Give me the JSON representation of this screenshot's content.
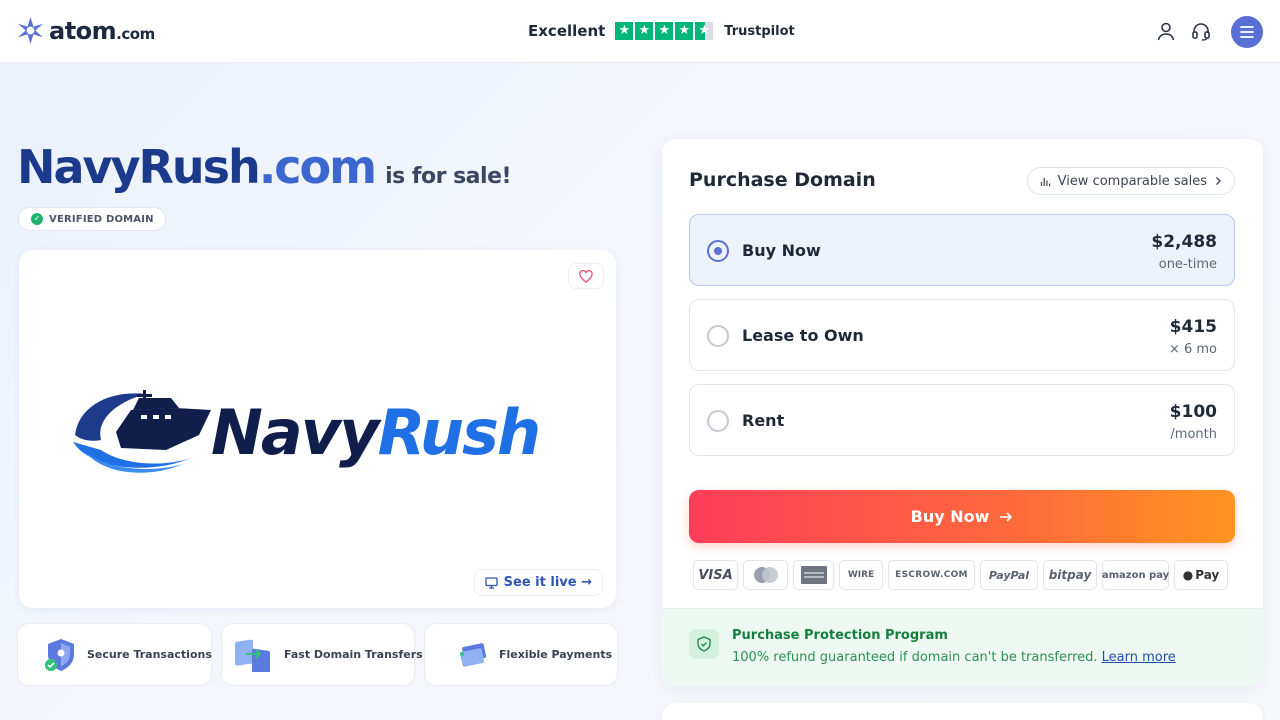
{
  "header": {
    "logo": {
      "main": "atom",
      "suffix": ".com"
    },
    "trust": {
      "label": "Excellent",
      "rating": 4.5,
      "provider": "Trustpilot"
    },
    "icons": [
      "user-icon",
      "headset-icon",
      "menu-icon"
    ]
  },
  "hero": {
    "domain_name": "NavyRush",
    "domain_tld": ".com",
    "for_sale": "is for sale!",
    "verified_badge": "VERIFIED DOMAIN"
  },
  "preview": {
    "brand_name": {
      "part1": "Navy",
      "part2": "Rush"
    },
    "see_live": "See it live →"
  },
  "features": [
    {
      "label": "Secure Transactions",
      "icon": "shield-icon"
    },
    {
      "label": "Fast Domain Transfers",
      "icon": "transfer-icon"
    },
    {
      "label": "Flexible Payments",
      "icon": "payment-card-icon"
    }
  ],
  "purchase": {
    "title": "Purchase Domain",
    "comparable_label": "View comparable sales",
    "options": [
      {
        "label": "Buy Now",
        "price": "$2,488",
        "sub": "one-time",
        "selected": true
      },
      {
        "label": "Lease to Own",
        "price": "$415",
        "sub": "× 6 mo",
        "selected": false
      },
      {
        "label": "Rent",
        "price": "$100",
        "sub": "/month",
        "selected": false
      }
    ],
    "buy_button": "Buy Now",
    "payment_methods": [
      "VISA",
      "Mastercard",
      "American Express",
      "WIRE",
      "ESCROW.COM",
      "PayPal",
      "bitpay",
      "amazon pay",
      "Pay"
    ],
    "protection": {
      "title": "Purchase Protection Program",
      "text": "100% refund guaranteed if domain can't be transferred.",
      "link": "Learn more"
    }
  },
  "colors": {
    "brand_blue": "#1b3a8c",
    "accent_blue": "#5a72d6",
    "cta_start": "#ff3d5a",
    "cta_end": "#ff9420",
    "trustpilot_green": "#00b67a",
    "protect_green": "#15803d"
  }
}
